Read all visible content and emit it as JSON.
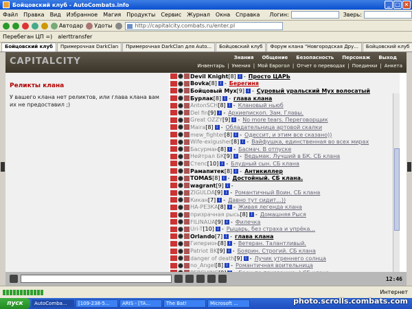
{
  "window": {
    "title": "Бойцовский клуб - AutoCombats.info"
  },
  "menu": {
    "items": [
      "Файл",
      "Правка",
      "Вид",
      "Избранное",
      "Магия",
      "Продукты",
      "Сервис",
      "Журнал",
      "Окна",
      "Справка"
    ],
    "login_label": "Логин:",
    "beast_label": "Зверь:"
  },
  "toolbar": {
    "autodar": "Автодар",
    "udoty": "Удоты",
    "url": "http://capitalcity.combats.ru/enter.pl"
  },
  "links": {
    "items": [
      "Перебеган ЦП =)",
      "alerttransfer"
    ]
  },
  "tabs": [
    "Бойцовский клуб",
    "Примерочная DarkClan",
    "Примерочная DarkClan для Auto...",
    "Бойцовский клуб",
    "Форум клана \"Новгородская Дру...",
    "Бойцовский клуб"
  ],
  "game": {
    "logo": "CAPITALCITY",
    "nav_top": [
      "Знания",
      "Общение",
      "Безопасность",
      "Персонаж",
      "Выход"
    ],
    "nav_sub": [
      "Инвентарь",
      "Умения",
      "Мой Еврогол",
      "Отчет о переводах",
      "Поединки",
      "Анкета"
    ],
    "left_title": "Реликты клана",
    "left_text": "У вашего клана нет реликтов, или глава клана вам их не предоставил ;)",
    "members": [
      {
        "name": "Devil Knight",
        "level": "[8]",
        "desc": "Просто ЦАРЬ",
        "style": "b",
        "online": true
      },
      {
        "name": "Bovka",
        "level": "[8]",
        "desc": "Берегиня",
        "style": "r",
        "online": true
      },
      {
        "name": "Бойцовый Мух",
        "level": "[9]",
        "desc": "Суровый уральский Мух волосатый",
        "style": "b",
        "online": true
      },
      {
        "name": "Бурлак",
        "level": "[8]",
        "desc": "глава клана",
        "style": "b",
        "online": true
      },
      {
        "name": "AntonSCH",
        "level": "[8]",
        "desc": "Клановый ньюб",
        "style": "g",
        "online": false
      },
      {
        "name": "Del fin",
        "level": "[9]",
        "desc": "Архиепископ. Зам. Главы.",
        "style": "g",
        "online": false
      },
      {
        "name": "Great OZZY",
        "level": "[9]",
        "desc": "No more tears. Переговорщик",
        "style": "g",
        "online": false
      },
      {
        "name": "Maira",
        "level": "[8]",
        "desc": "Обладательница артовой скалки",
        "style": "g",
        "online": false
      },
      {
        "name": "mew_fighter",
        "level": "[8]",
        "desc": "Одессит, и этим все сказано))",
        "style": "g",
        "online": false
      },
      {
        "name": "Wife-exigusher",
        "level": "[8]",
        "desc": "Вайфушка, единственная во всех мирах",
        "style": "g",
        "online": false
      },
      {
        "name": "Басурман",
        "level": "[8]",
        "desc": "Басмач. В отпуске",
        "style": "g",
        "online": false
      },
      {
        "name": "Нейтрал БК",
        "level": "[9]",
        "desc": "Ведьмак. Лучший в БК. СБ клана",
        "style": "g",
        "online": false
      },
      {
        "name": "Степс",
        "level": "[10]",
        "desc": "Блудный сын. СБ клана",
        "style": "g",
        "online": false
      },
      {
        "name": "Рамапитек",
        "level": "[8]",
        "desc": "Антикиллер",
        "style": "b",
        "online": true
      },
      {
        "name": "TOMAS",
        "level": "[8]",
        "desc": "Достойный. СБ клана.",
        "style": "b",
        "online": true
      },
      {
        "name": "wagrant",
        "level": "[9]",
        "desc": "",
        "style": "b",
        "online": true
      },
      {
        "name": "ZIGULDA",
        "level": "[9]",
        "desc": "Романтичный Воин. СБ клана",
        "style": "g",
        "online": false
      },
      {
        "name": "Кикан",
        "level": "[7]",
        "desc": "Давно тут сидит...))",
        "style": "g",
        "online": false
      },
      {
        "name": "НА-РЕЗКА",
        "level": "[8]",
        "desc": "Живая легенда клана",
        "style": "g",
        "online": false
      },
      {
        "name": "призрачная рысь",
        "level": "[8]",
        "desc": "Домашняя Рыся",
        "style": "g",
        "online": false
      },
      {
        "name": "FILINAUA",
        "level": "[9]",
        "desc": "Филечка",
        "style": "g",
        "online": false
      },
      {
        "name": "Uri-T",
        "level": "[10]",
        "desc": "Рыцарь, без страха и упрёка...",
        "style": "g",
        "online": false
      },
      {
        "name": "Orlando",
        "level": "[7]",
        "desc": "глава клана",
        "style": "b",
        "online": true
      },
      {
        "name": "Гиперион",
        "level": "[8]",
        "desc": "Ветеран. Талантливый.",
        "style": "g",
        "online": false
      },
      {
        "name": "Patriot BK",
        "level": "[9]",
        "desc": "Боярин. Строгий. СБ клана",
        "style": "g",
        "online": false
      },
      {
        "name": "danger of death",
        "level": "[9]",
        "desc": "Лучик утреннего солнца",
        "style": "g",
        "online": false
      },
      {
        "name": "no_Angel",
        "level": "[8]",
        "desc": "Романтичная воительница",
        "style": "g",
        "online": false
      },
      {
        "name": "PERSHING",
        "level": "[9]",
        "desc": "Брец по призванию :) СБ клана",
        "style": "g",
        "online": false
      }
    ],
    "clock": "12:46"
  },
  "status": {
    "internet": "Интернет"
  },
  "taskbar": {
    "start": "пуск",
    "tasks": [
      "AutoComba...",
      "[109-238-5...",
      "ARIS - [TA...",
      "The Bat!",
      "Microsoft ..."
    ]
  },
  "watermark": "photo.scrolls.combats.com"
}
